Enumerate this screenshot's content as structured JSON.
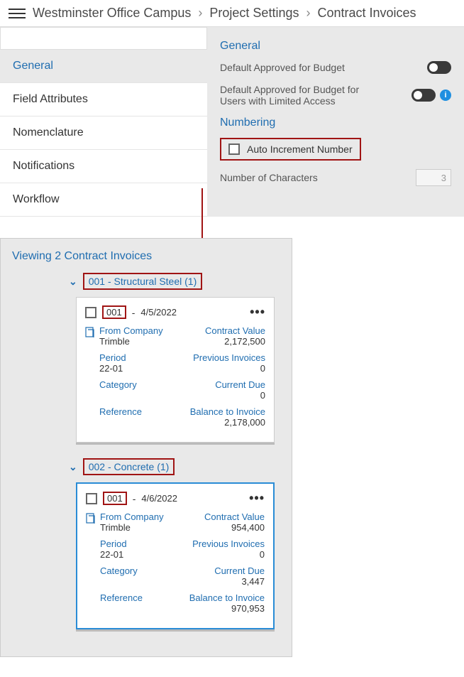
{
  "breadcrumb": {
    "project": "Westminster Office Campus",
    "settings": "Project Settings",
    "page": "Contract Invoices"
  },
  "nav": {
    "general": "General",
    "field_attributes": "Field Attributes",
    "nomenclature": "Nomenclature",
    "notifications": "Notifications",
    "workflow": "Workflow"
  },
  "settings": {
    "general_title": "General",
    "default_approved": "Default Approved for Budget",
    "default_approved_limited": "Default Approved for Budget for Users with Limited Access",
    "numbering_title": "Numbering",
    "auto_increment": "Auto Increment Number",
    "num_chars_label": "Number of Characters",
    "num_chars_value": "3"
  },
  "panel": {
    "title": "Viewing 2 Contract Invoices",
    "groups": [
      {
        "label": "001 - Structural Steel (1)",
        "invoice": {
          "number": "001",
          "date": "4/5/2022",
          "from_label": "From Company",
          "from_value": "Trimble",
          "contract_value_label": "Contract Value",
          "contract_value": "2,172,500",
          "period_label": "Period",
          "period_value": "22-01",
          "previous_label": "Previous Invoices",
          "previous_value": "0",
          "category_label": "Category",
          "current_due_label": "Current Due",
          "current_due_value": "0",
          "reference_label": "Reference",
          "balance_label": "Balance to Invoice",
          "balance_value": "2,178,000"
        }
      },
      {
        "label": "002 - Concrete (1)",
        "invoice": {
          "number": "001",
          "date": "4/6/2022",
          "from_label": "From Company",
          "from_value": "Trimble",
          "contract_value_label": "Contract Value",
          "contract_value": "954,400",
          "period_label": "Period",
          "period_value": "22-01",
          "previous_label": "Previous Invoices",
          "previous_value": "0",
          "category_label": "Category",
          "current_due_label": "Current Due",
          "current_due_value": "3,447",
          "reference_label": "Reference",
          "balance_label": "Balance to Invoice",
          "balance_value": "970,953"
        }
      }
    ]
  }
}
